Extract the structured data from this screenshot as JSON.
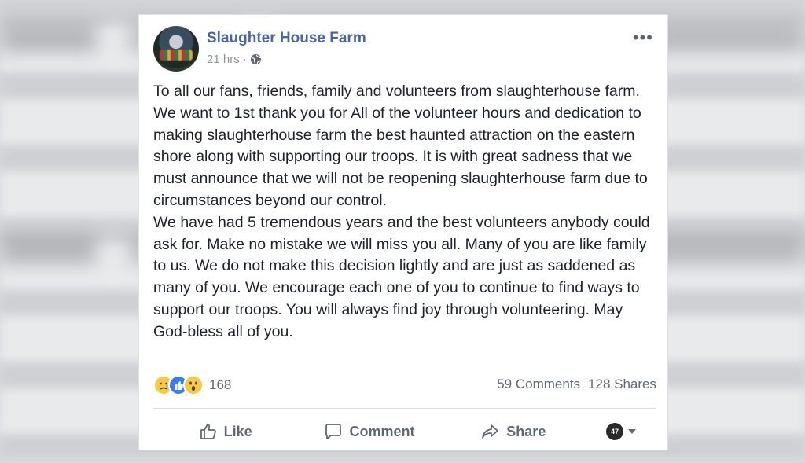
{
  "post": {
    "page_name": "Slaughter House Farm",
    "time": "21 hrs",
    "privacy_separator": "·",
    "paragraphs": [
      "To all our fans, friends, family and volunteers from slaughterhouse farm. We want to 1st thank you for All of the volunteer hours and dedication to making slaughterhouse farm the best haunted attraction on the eastern shore along with supporting our troops. It is with great sadness that we must announce that we will not be reopening slaughterhouse farm due to circumstances beyond our control.",
      "We have had 5 tremendous years and the best volunteers anybody could ask for. Make no mistake we will miss you all. Many of you are like family to us. We do not make this decision lightly and are just as saddened as many of you. We encourage each one of you to continue to find ways to support our troops. You will always find joy through volunteering. May God-bless all of you."
    ]
  },
  "stats": {
    "reaction_count": "168",
    "comments": "59 Comments",
    "shares": "128 Shares",
    "reaction_icons": [
      "sad-reaction-icon",
      "like-reaction-icon",
      "wow-reaction-icon"
    ]
  },
  "actions": {
    "like": "Like",
    "comment": "Comment",
    "share": "Share"
  },
  "colors": {
    "page_name": "#4b67a1",
    "meta": "#90949c",
    "text": "#1d2129",
    "action": "#606770"
  }
}
